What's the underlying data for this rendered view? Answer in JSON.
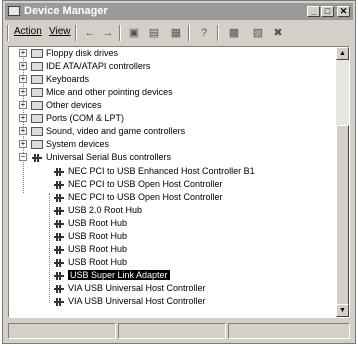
{
  "window": {
    "title": "Device Manager",
    "title_bar_color": "#9a9a9a"
  },
  "title_buttons": {
    "minimize": "_",
    "maximize": "□",
    "close": "✕"
  },
  "menubar": {
    "action": "Action",
    "view": "View"
  },
  "toolbar": {
    "icons": [
      "back-arrow-icon",
      "forward-arrow-icon",
      "up-folder-icon",
      "show-hide-tree-icon",
      "properties-icon",
      "help-icon",
      "scan-hardware-icon",
      "update-driver-icon",
      "uninstall-icon"
    ]
  },
  "tree": {
    "collapsed_items": [
      "Floppy disk drives",
      "IDE ATA/ATAPI controllers",
      "Keyboards",
      "Mice and other pointing devices",
      "Other devices",
      "Ports (COM & LPT)",
      "Sound, video and game controllers",
      "System devices"
    ],
    "expanded_item": "Universal Serial Bus controllers",
    "children": [
      "NEC PCI to USB Enhanced Host Controller B1",
      "NEC PCI to USB Open Host Controller",
      "NEC PCI to USB Open Host Controller",
      "USB 2.0 Root Hub",
      "USB Root Hub",
      "USB Root Hub",
      "USB Root Hub",
      "USB Root Hub",
      "USB Super Link Adapter",
      "VIA USB Universal Host Controller",
      "VIA USB Universal Host Controller"
    ],
    "selected_child": "USB Super Link Adapter",
    "expand_symbol": "+",
    "collapse_symbol": "−"
  },
  "scrollbar": {
    "up": "▲",
    "down": "▼"
  }
}
